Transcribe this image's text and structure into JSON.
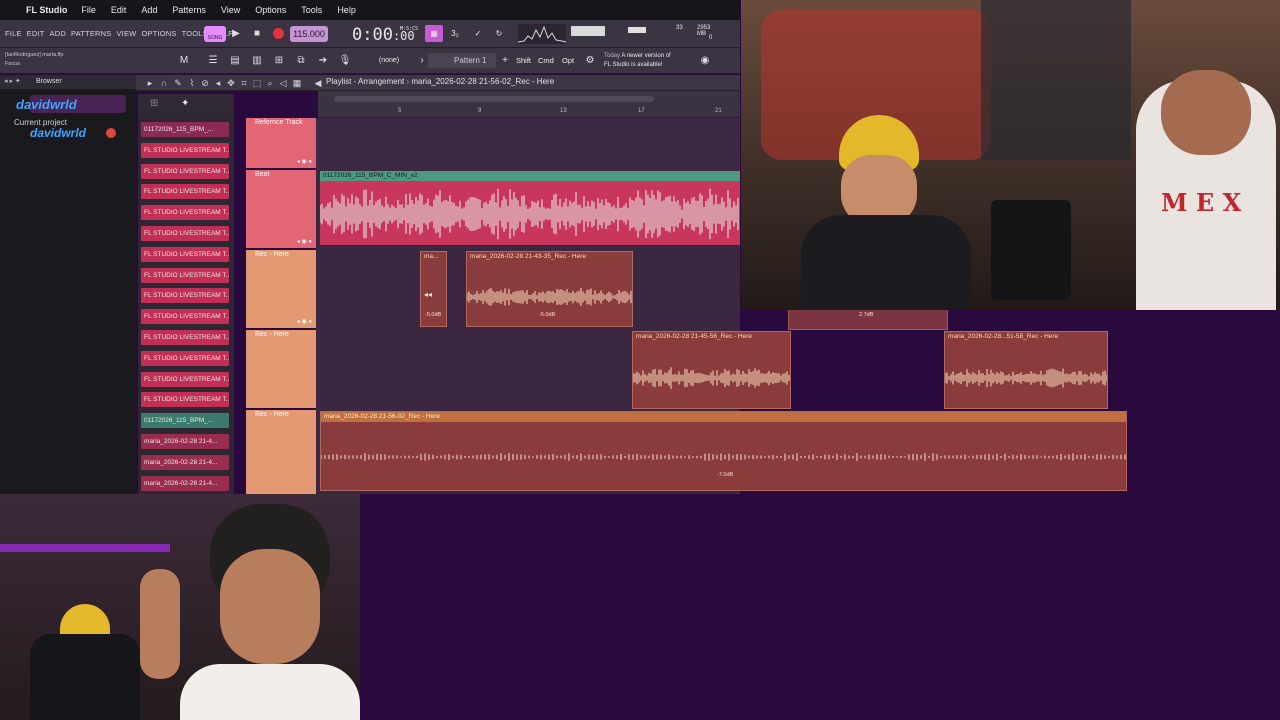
{
  "menubar": {
    "app_name": "FL Studio",
    "items": [
      "File",
      "Edit",
      "Add",
      "Patterns",
      "View",
      "Options",
      "Tools",
      "Help"
    ]
  },
  "fl_menu": {
    "items": [
      "FILE",
      "EDIT",
      "ADD",
      "PATTERNS",
      "VIEW",
      "OPTIONS",
      "TOOLS",
      "HELP"
    ],
    "pat_song_label": "SONG",
    "tempo": "115.000",
    "time": "0:00",
    "time_fraction": ":00",
    "time_ms": "M:S:CS",
    "cpu_value": "33",
    "memory": "2953 MB",
    "memory_sub": "0"
  },
  "toolbar2": {
    "hint_line1": "[IanRodriguez] maria.flp",
    "hint_line2": "Focus",
    "snap": "(none)",
    "pattern": "Pattern 1",
    "keys": [
      "Shift",
      "Cmd",
      "Opt"
    ],
    "news_line1_dim": "Today",
    "news_line1": "A newer version of",
    "news_line2": "FL Studio is available!"
  },
  "browser": {
    "title": "Browser",
    "streamer_name": "davidwrld",
    "current_project": "Current project",
    "streamer_name2": "davidwrld"
  },
  "picker": {
    "items": [
      {
        "label": "01172026_115_BPM_...",
        "kind": "sel2"
      },
      {
        "label": "FL STUDIO LIVESTREAM T...",
        "kind": "normal"
      },
      {
        "label": "FL STUDIO LIVESTREAM T...",
        "kind": "normal"
      },
      {
        "label": "FL STUDIO LIVESTREAM T...",
        "kind": "normal"
      },
      {
        "label": "FL STUDIO LIVESTREAM T...",
        "kind": "normal"
      },
      {
        "label": "FL STUDIO LIVESTREAM T...",
        "kind": "normal"
      },
      {
        "label": "FL STUDIO LIVESTREAM T...",
        "kind": "normal"
      },
      {
        "label": "FL STUDIO LIVESTREAM T...",
        "kind": "normal"
      },
      {
        "label": "FL STUDIO LIVESTREAM T...",
        "kind": "normal"
      },
      {
        "label": "FL STUDIO LIVESTREAM T...",
        "kind": "normal"
      },
      {
        "label": "FL STUDIO LIVESTREAM T...",
        "kind": "normal"
      },
      {
        "label": "FL STUDIO LIVESTREAM T...",
        "kind": "normal"
      },
      {
        "label": "FL STUDIO LIVESTREAM T...",
        "kind": "normal"
      },
      {
        "label": "FL STUDIO LIVESTREAM T...",
        "kind": "normal"
      },
      {
        "label": "01172026_115_BPM_...",
        "kind": "sel"
      },
      {
        "label": "maria_2026-02-28 21-4...",
        "kind": "rec"
      },
      {
        "label": "maria_2026-02-28 21-4...",
        "kind": "rec"
      },
      {
        "label": "maria_2026-02-28 21-4...",
        "kind": "rec"
      }
    ]
  },
  "playlist": {
    "title": "Playlist - Arrangement",
    "arrangement": "maria_2026-02-28 21-56-02_Rec - Here",
    "ruler": [
      "5",
      "9",
      "13",
      "17",
      "21"
    ],
    "tracks": [
      {
        "label": "Refernce Track"
      },
      {
        "label": "Beat"
      },
      {
        "label": "Rec - Here"
      },
      {
        "label": "Rec - Here"
      },
      {
        "label": "Rec - Here"
      }
    ],
    "beat_clip": "01172026_115_BPM_C_MIN_v2",
    "rec1_small": "ma...",
    "rec1_small_db": "-5.0dB",
    "rec1_clip": "maria_2026-02-28 21-43-35_Rec - Here",
    "rec1_db": "-5.0dB",
    "rec1_ext_db": "2.7dB",
    "rec2_clip": "maria_2026-02-28 21-45-56_Rec - Here",
    "rec2_clip_b": "maria_2026-02-28...51-58_Rec - Here",
    "rec2_clip_c": "ma...",
    "rec3_clip": "maria_2026-02-28 21-56-02_Rec - Here",
    "rec3_db": "-7.0dB"
  },
  "colors": {
    "beat": "#c9365b",
    "rec": "#8a3b3c",
    "track_head": "#e26674",
    "background": "#2a0a3e"
  }
}
